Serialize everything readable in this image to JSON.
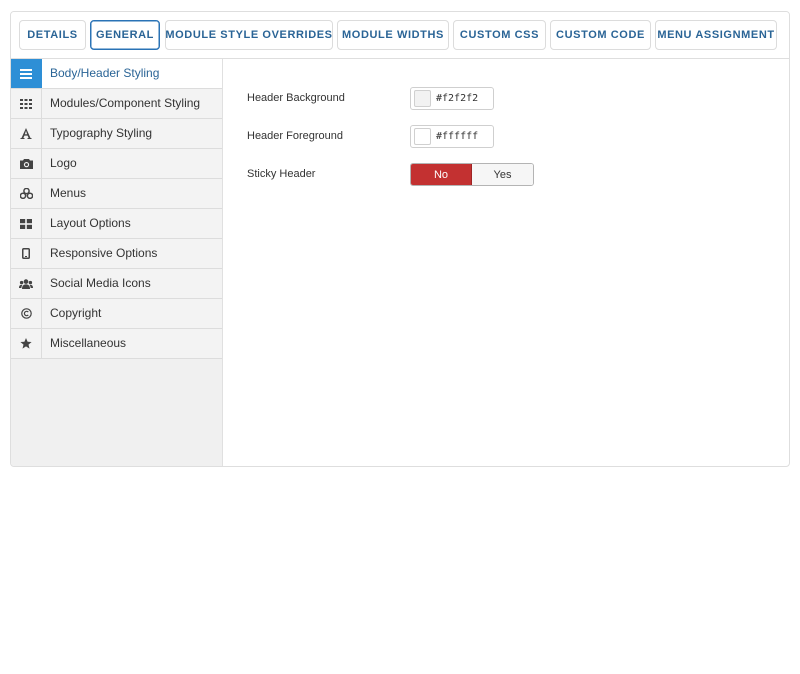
{
  "tabs": [
    {
      "label": "DETAILS",
      "active": false
    },
    {
      "label": "GENERAL",
      "active": true
    },
    {
      "label": "MODULE STYLE OVERRIDES",
      "active": false
    },
    {
      "label": "MODULE WIDTHS",
      "active": false
    },
    {
      "label": "CUSTOM CSS",
      "active": false
    },
    {
      "label": "CUSTOM CODE",
      "active": false
    },
    {
      "label": "MENU ASSIGNMENT",
      "active": false
    }
  ],
  "sidebar": {
    "items": [
      {
        "label": "Body/Header Styling",
        "icon": "bars-icon",
        "active": true
      },
      {
        "label": "Modules/Component Styling",
        "icon": "grid-icon",
        "active": false
      },
      {
        "label": "Typography Styling",
        "icon": "font-icon",
        "active": false
      },
      {
        "label": "Logo",
        "icon": "camera-icon",
        "active": false
      },
      {
        "label": "Menus",
        "icon": "cubes-icon",
        "active": false
      },
      {
        "label": "Layout Options",
        "icon": "layout-icon",
        "active": false
      },
      {
        "label": "Responsive Options",
        "icon": "mobile-icon",
        "active": false
      },
      {
        "label": "Social Media Icons",
        "icon": "users-icon",
        "active": false
      },
      {
        "label": "Copyright",
        "icon": "copyright-icon",
        "active": false
      },
      {
        "label": "Miscellaneous",
        "icon": "star-icon",
        "active": false
      }
    ]
  },
  "form": {
    "header_background": {
      "label": "Header Background",
      "value": "#f2f2f2",
      "swatch": "#f2f2f2"
    },
    "header_foreground": {
      "label": "Header Foreground",
      "value": "#ffffff",
      "swatch": "#ffffff"
    },
    "sticky_header": {
      "label": "Sticky Header",
      "options": [
        "No",
        "Yes"
      ],
      "selected": "No"
    }
  },
  "colors": {
    "accent": "#2e8fd6",
    "tab_text": "#2a6496",
    "toggle_no": "#c33131"
  }
}
